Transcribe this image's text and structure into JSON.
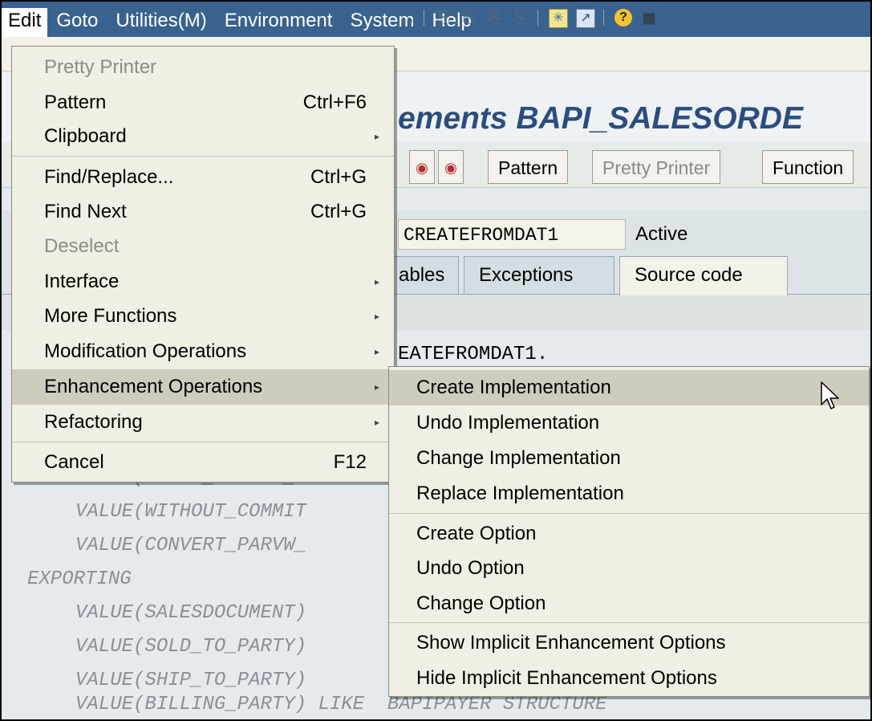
{
  "menubar": {
    "items": [
      "Edit",
      "Goto",
      "Utilities(M)",
      "Environment",
      "System",
      "Help"
    ]
  },
  "title": "ements BAPI_SALESORDE",
  "app_toolbar": {
    "pattern": "Pattern",
    "pretty_printer": "Pretty Printer",
    "function": "Function"
  },
  "function_module": {
    "name": "CREATEFROMDAT1",
    "status": "Active"
  },
  "tabs": [
    "ables",
    "Exceptions",
    "Source code"
  ],
  "code_lines": [
    "EATEFROMDAT1.",
    "VALUE(ORDER_HEADER_",
    "VALUE(WITHOUT_COMMIT",
    "VALUE(CONVERT_PARVW_",
    "EXPORTING",
    "VALUE(SALESDOCUMENT)",
    "VALUE(SOLD_TO_PARTY)",
    "VALUE(SHIP_TO_PARTY)",
    "VALUE(BILLING_PARTY) LIKE  BAPIPAYER STRUCTURE"
  ],
  "edit_menu": {
    "items": [
      {
        "label": "Pretty Printer",
        "shortcut": "",
        "submenu": false,
        "disabled": true
      },
      {
        "label": "Pattern",
        "shortcut": "Ctrl+F6",
        "submenu": false,
        "disabled": false
      },
      {
        "label": "Clipboard",
        "shortcut": "",
        "submenu": true,
        "disabled": false
      },
      {
        "label": "Find/Replace...",
        "shortcut": "Ctrl+G",
        "submenu": false,
        "disabled": false
      },
      {
        "label": "Find Next",
        "shortcut": "Ctrl+G",
        "submenu": false,
        "disabled": false
      },
      {
        "label": "Deselect",
        "shortcut": "",
        "submenu": false,
        "disabled": true
      },
      {
        "label": "Interface",
        "shortcut": "",
        "submenu": true,
        "disabled": false
      },
      {
        "label": "More Functions",
        "shortcut": "",
        "submenu": true,
        "disabled": false
      },
      {
        "label": "Modification Operations",
        "shortcut": "",
        "submenu": true,
        "disabled": false
      },
      {
        "label": "Enhancement Operations",
        "shortcut": "",
        "submenu": true,
        "disabled": false,
        "highlighted": true
      },
      {
        "label": "Refactoring",
        "shortcut": "",
        "submenu": true,
        "disabled": false
      },
      {
        "label": "Cancel",
        "shortcut": "F12",
        "submenu": false,
        "disabled": false
      }
    ]
  },
  "enhancement_submenu": {
    "items": [
      {
        "label": "Create Implementation",
        "highlighted": true
      },
      {
        "label": "Undo Implementation"
      },
      {
        "label": "Change Implementation"
      },
      {
        "label": "Replace Implementation"
      },
      {
        "label": "Create Option"
      },
      {
        "label": "Undo Option"
      },
      {
        "label": "Change Option"
      },
      {
        "label": "Show Implicit Enhancement Options"
      },
      {
        "label": "Hide Implicit Enhancement Options"
      }
    ]
  },
  "colors": {
    "menubar": "#39628f",
    "menu_bg": "#efefe4",
    "highlight": "#cfccbe",
    "title": "#2b4d7e"
  }
}
